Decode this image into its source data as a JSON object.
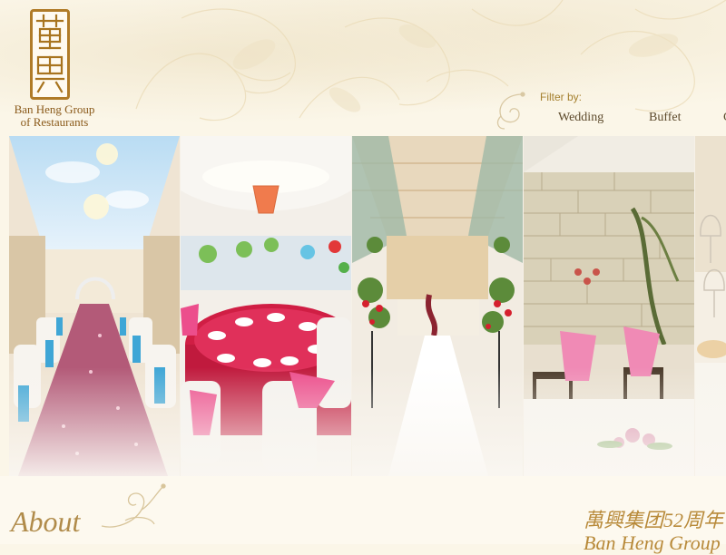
{
  "brand": {
    "logo_chars": "萬興",
    "name_line1": "Ban Heng Group",
    "name_line2": "of Restaurants"
  },
  "filter": {
    "label": "Filter by:",
    "items": [
      "Wedding",
      "Buffet",
      "C"
    ]
  },
  "gallery": {
    "panels": [
      "wedding-hall-aisle",
      "banquet-table-setting",
      "aisle-with-flowers",
      "stone-wall-decor",
      "table-glassware"
    ]
  },
  "about": {
    "title": "About",
    "chinese_title": "萬興集团52周年",
    "english_title": "Ban Heng Group"
  },
  "colors": {
    "gold": "#b08b4a",
    "brand_brown": "#8a5a1a",
    "background": "#fbf6e8"
  }
}
